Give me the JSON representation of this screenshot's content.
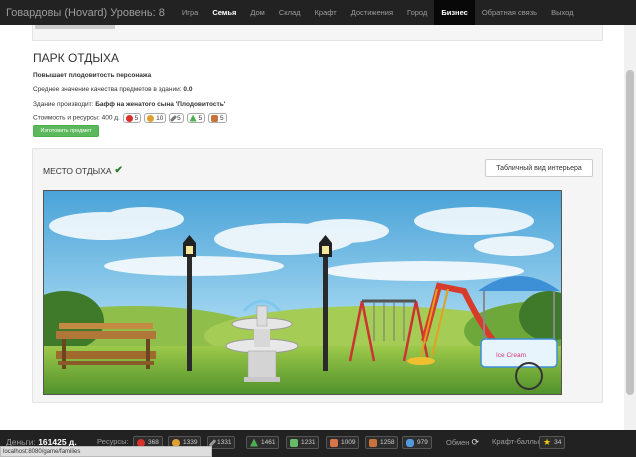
{
  "navbar": {
    "brand": "Говардовы (Hovard) Уровень: 8",
    "items": [
      "Игра",
      "Семья",
      "Дом",
      "Склад",
      "Крафт",
      "Достижения",
      "Город",
      "Бизнес",
      "Обратная связь",
      "Выход"
    ],
    "active": "Бизнес",
    "bold": "Семья"
  },
  "building": {
    "title": "ПАРК ОТДЫХА",
    "effect": "Повышает плодовитость персонажа",
    "quality_label": "Среднее значение качества предметов в здании:",
    "quality_value": "0.0",
    "produces_label": "Здание производит:",
    "produces_value": "Бафф на женатого сына 'Плодовитость'",
    "cost_label": "Стоимость и ресурсы:",
    "cost_value": "400 д.",
    "resources": [
      {
        "icon": "apple-icon",
        "color": "#d9302a",
        "amount": "5"
      },
      {
        "icon": "bread-icon",
        "color": "#e0a030",
        "amount": "10"
      },
      {
        "icon": "tool-icon",
        "color": "#777777",
        "amount": "5"
      },
      {
        "icon": "recycle-icon",
        "color": "#4caf50",
        "amount": "5"
      },
      {
        "icon": "brick-icon",
        "color": "#c8733a",
        "amount": "5"
      }
    ],
    "make_button": "Изготовить предмет"
  },
  "place": {
    "title": "МЕСТО ОТДЫХА",
    "view_button": "Табличный вид интерьера",
    "scene_items": [
      "bench",
      "lamp-post",
      "fountain",
      "lamp-post",
      "swings",
      "slide",
      "ice-cream-cart"
    ],
    "ice_cream_text": "Ice Cream"
  },
  "bottom": {
    "money_label": "Деньги:",
    "money_value": "161425 д.",
    "resources_label": "Ресурсы:",
    "resources": [
      {
        "icon": "apple-icon",
        "color": "#d9302a",
        "amount": "368"
      },
      {
        "icon": "bread-icon",
        "color": "#e0a030",
        "amount": "1339"
      },
      {
        "icon": "tool-icon",
        "color": "#999999",
        "amount": "1331"
      },
      {
        "icon": "recycle-icon",
        "color": "#4caf50",
        "amount": "1461"
      },
      {
        "icon": "cloth-icon",
        "color": "#66bb66",
        "amount": "1231"
      },
      {
        "icon": "books-icon",
        "color": "#d9734a",
        "amount": "1009"
      },
      {
        "icon": "brick-icon",
        "color": "#c8733a",
        "amount": "1258"
      },
      {
        "icon": "glove-icon",
        "color": "#5599dd",
        "amount": "979"
      }
    ],
    "exchange_label": "Обмен",
    "craft_points_label": "Крафт-баллы:",
    "craft_points_value": "34"
  },
  "status_url": "localhost:8080/game/families"
}
